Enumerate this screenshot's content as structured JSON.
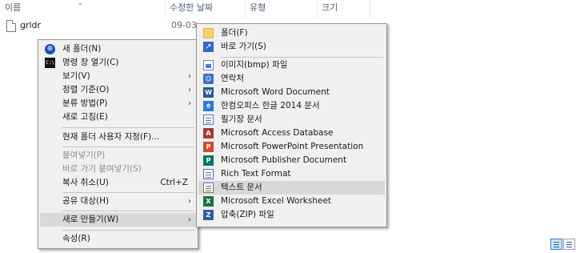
{
  "columns": {
    "name": "이름",
    "modified": "수정한 날짜",
    "type": "유형",
    "size": "크기"
  },
  "file": {
    "name": "grldr",
    "date": "09-03-3"
  },
  "context_menu": {
    "items": [
      {
        "label": "새 폴더(N)",
        "icon": "globe-icon"
      },
      {
        "label": "명령 창 열기(C)",
        "icon": "command-prompt-icon"
      },
      {
        "label": "보기(V)",
        "arrow": "›"
      },
      {
        "label": "정렬 기준(O)",
        "arrow": "›"
      },
      {
        "label": "분류 방법(P)",
        "arrow": "›"
      },
      {
        "label": "새로 고침(E)"
      },
      {
        "label": "현재 폴더 사용자 지정(F)..."
      },
      {
        "label": "붙여넣기(P)"
      },
      {
        "label": "바로 가기 붙여넣기(S)"
      },
      {
        "label": "복사 취소(U)",
        "shortcut": "Ctrl+Z"
      },
      {
        "label": "공유 대상(H)",
        "arrow": "›"
      },
      {
        "label": "새로 만들기(W)",
        "arrow": "›"
      },
      {
        "label": "속성(R)"
      }
    ]
  },
  "new_submenu": {
    "items": [
      {
        "label": "폴더(F)",
        "icon": "folder-icon"
      },
      {
        "label": "바로 가기(S)",
        "icon": "shortcut-icon",
        "glyph": "↗"
      },
      {
        "label": "이미지(bmp) 파일",
        "icon": "image-icon"
      },
      {
        "label": "연락처",
        "icon": "contact-icon",
        "glyph": "☺"
      },
      {
        "label": "Microsoft Word Document",
        "icon": "word-icon",
        "glyph": "W"
      },
      {
        "label": "한컴오피스 한글 2014 문서",
        "icon": "hwp-icon",
        "glyph": "ㅎ"
      },
      {
        "label": "필기장 문서",
        "icon": "journal-icon"
      },
      {
        "label": "Microsoft Access Database",
        "icon": "access-icon",
        "glyph": "A"
      },
      {
        "label": "Microsoft PowerPoint Presentation",
        "icon": "powerpoint-icon",
        "glyph": "P"
      },
      {
        "label": "Microsoft Publisher Document",
        "icon": "publisher-icon",
        "glyph": "P"
      },
      {
        "label": "Rich Text Format",
        "icon": "rtf-icon"
      },
      {
        "label": "텍스트 문서",
        "icon": "text-document-icon"
      },
      {
        "label": "Microsoft Excel Worksheet",
        "icon": "excel-icon",
        "glyph": "X"
      },
      {
        "label": "압축(ZIP) 파일",
        "icon": "zip-icon",
        "glyph": "Z"
      }
    ]
  }
}
